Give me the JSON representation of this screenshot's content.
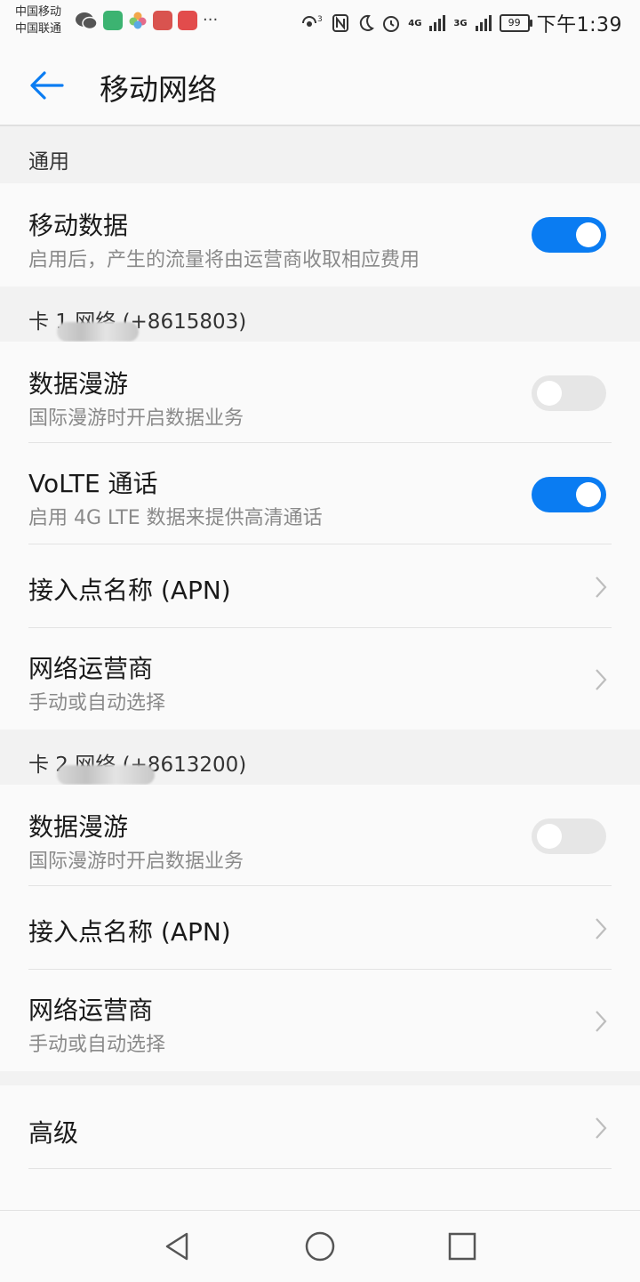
{
  "status_bar": {
    "carrier_1": "中国移动",
    "carrier_2": "中国联通",
    "network_1": "4G",
    "network_2": "3G",
    "battery": "99",
    "time": "下午1:39",
    "icons": [
      "wechat-icon",
      "app-icon",
      "photos-icon",
      "huawei-store-icon",
      "huawei-icon",
      "more-dots-icon",
      "nfc-icon",
      "moon-icon",
      "alarm-icon",
      "signal-icon"
    ]
  },
  "app_bar": {
    "title": "移动网络"
  },
  "sections": {
    "general": {
      "header": "通用",
      "mobile_data": {
        "title": "移动数据",
        "subtitle": "启用后，产生的流量将由运营商收取相应费用",
        "enabled": true
      }
    },
    "sim1": {
      "header_prefix": "卡 1 网络 (+861580",
      "header_suffix": "3)",
      "roaming": {
        "title": "数据漫游",
        "subtitle": "国际漫游时开启数据业务",
        "enabled": false
      },
      "volte": {
        "title": "VoLTE 通话",
        "subtitle": "启用 4G LTE 数据来提供高清通话",
        "enabled": true
      },
      "apn": {
        "title": "接入点名称 (APN)"
      },
      "operator": {
        "title": "网络运营商",
        "subtitle": "手动或自动选择"
      }
    },
    "sim2": {
      "header_prefix": "卡 2 网络 (+86132",
      "header_suffix": "00)",
      "roaming": {
        "title": "数据漫游",
        "subtitle": "国际漫游时开启数据业务",
        "enabled": false
      },
      "apn": {
        "title": "接入点名称 (APN)"
      },
      "operator": {
        "title": "网络运营商",
        "subtitle": "手动或自动选择"
      }
    },
    "advanced": {
      "title": "高级"
    }
  },
  "colors": {
    "accent": "#0a7cf2",
    "toggle_off": "#e6e6e6",
    "background": "#f2f2f2",
    "surface": "#fafafa"
  }
}
